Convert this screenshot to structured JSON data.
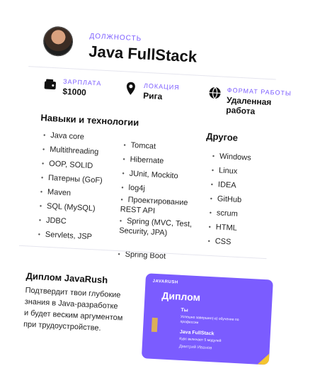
{
  "header": {
    "role_caption": "ДОЛЖНОСТЬ",
    "role_title": "Java FullStack"
  },
  "meta": {
    "salary": {
      "label": "ЗАРПЛАТА",
      "value": "$1000",
      "icon": "wallet-icon"
    },
    "location": {
      "label": "ЛОКАЦИЯ",
      "value": "Рига",
      "icon": "map-pin-icon"
    },
    "format": {
      "label": "ФОРМАТ РАБОТЫ",
      "value": "Удаленная работа",
      "icon": "globe-icon"
    }
  },
  "skills": {
    "title": "Навыки и технологии",
    "column1": [
      "Java core",
      "Multithreading",
      "OOP, SOLID",
      "Патерны (GoF)",
      "Maven",
      "SQL (MySQL)",
      "JDBC",
      "Servlets, JSP"
    ],
    "column2": [
      "Tomcat",
      "Hibernate",
      "JUnit, Mockito",
      "log4j",
      "Проектирование REST API",
      "Spring (MVC, Test, Security, JPA)",
      "Spring Boot"
    ]
  },
  "other": {
    "title": "Другое",
    "items": [
      "Windows",
      "Linux",
      "IDEA",
      "GitHub",
      "scrum",
      "HTML",
      "CSS"
    ]
  },
  "diploma": {
    "title": "Диплом JavaRush",
    "text": "Подтвердит твои глубокие знания в Java-разработке и будет веским аргументом при трудоустройстве."
  },
  "certificate": {
    "brand": "JAVARUSH",
    "heading": "Диплом",
    "name": "Ты",
    "description": "Успешно завершил(-а) обучение по профессии",
    "course": "Java FullStack",
    "modules": "Курс включает 5 модулей",
    "signature": "Дмитрий Иванов"
  },
  "colors": {
    "accent": "#7b5cff",
    "certificate_corner": "#f4c430"
  }
}
